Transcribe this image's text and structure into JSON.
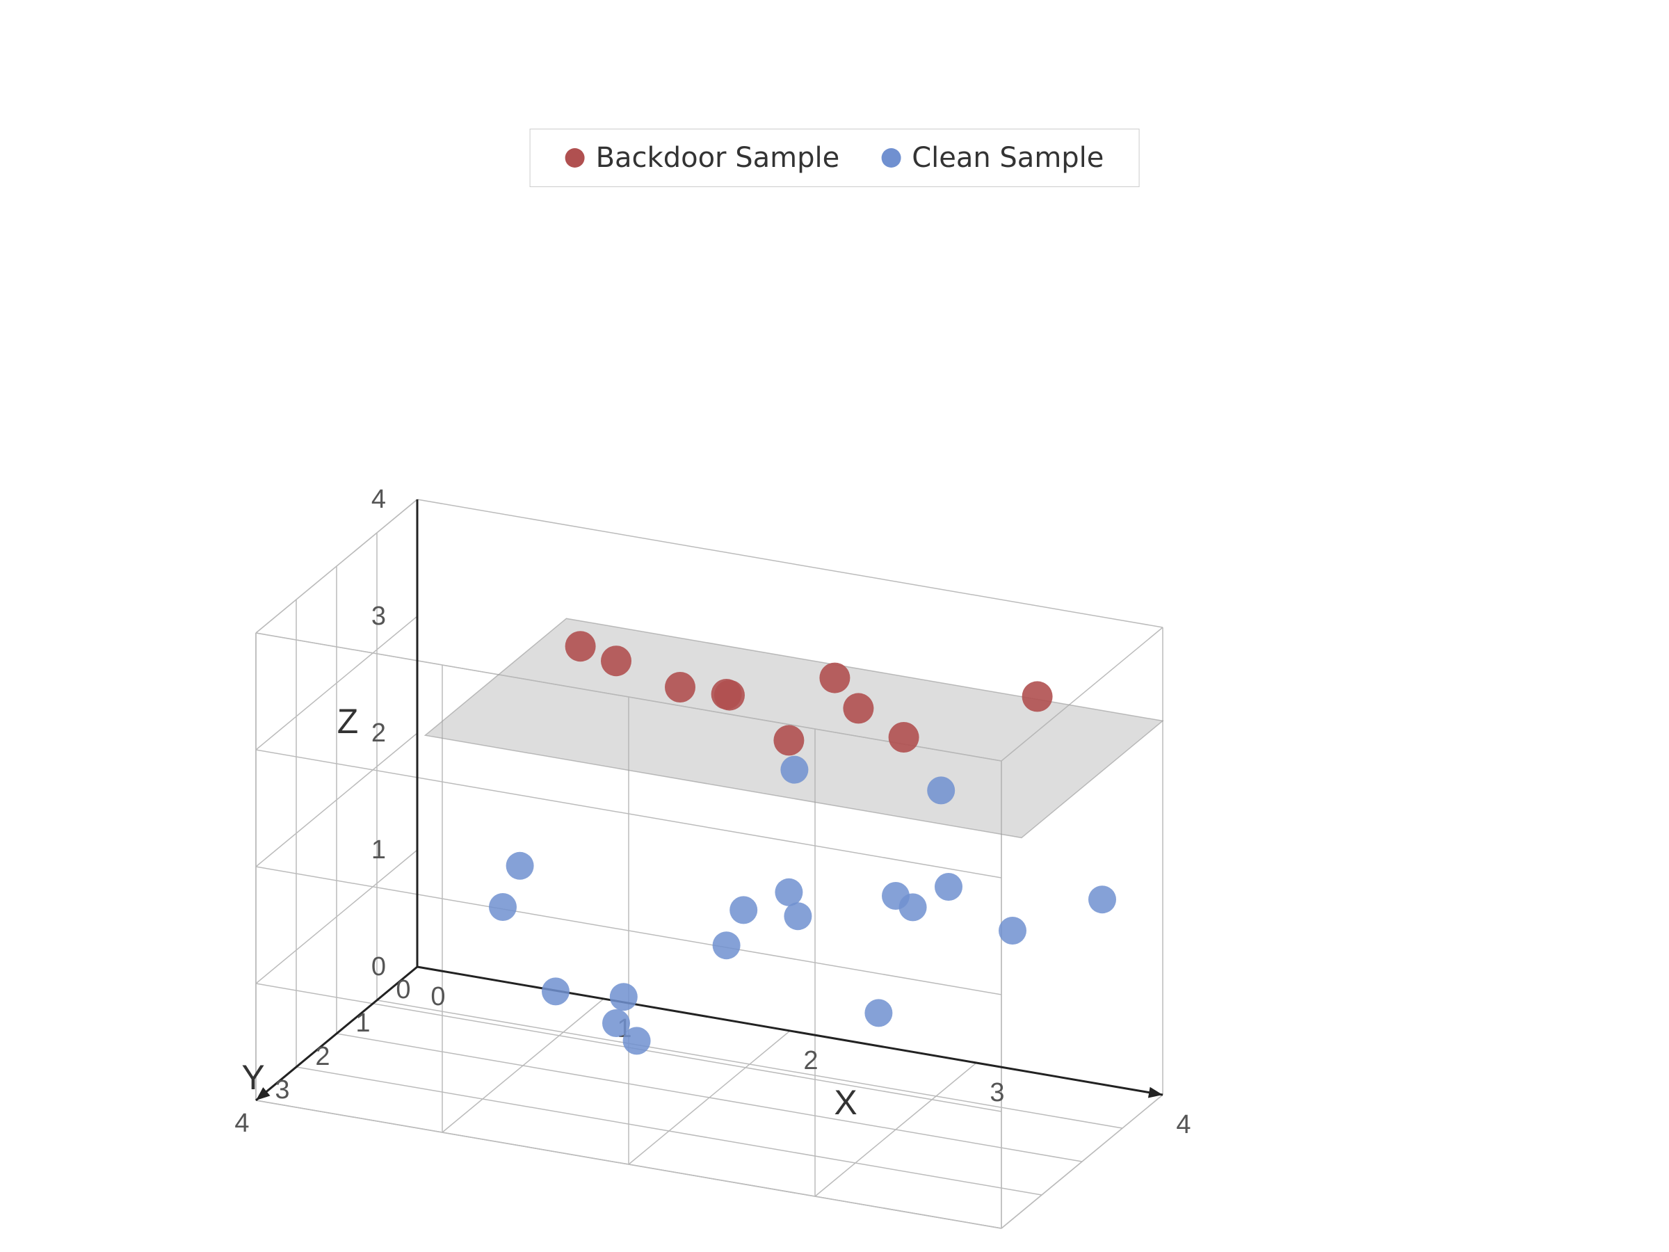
{
  "legend": {
    "backdoor_label": "Backdoor Sample",
    "clean_label": "Clean Sample",
    "backdoor_color": "#b05050",
    "clean_color": "#7090d0"
  },
  "axes": {
    "x_label": "X",
    "y_label": "Y",
    "z_label": "Z",
    "x_ticks": [
      "0",
      "1",
      "2",
      "3",
      "4"
    ],
    "y_ticks": [
      "0",
      "1",
      "2",
      "3",
      "4"
    ],
    "z_ticks": [
      "0",
      "1",
      "2",
      "3",
      "4"
    ]
  },
  "backdoor_points": [
    {
      "x": 1.2,
      "y": 1.5,
      "z": 3.5
    },
    {
      "x": 1.5,
      "y": 2.0,
      "z": 3.6
    },
    {
      "x": 1.8,
      "y": 1.8,
      "z": 3.4
    },
    {
      "x": 2.0,
      "y": 1.5,
      "z": 3.3
    },
    {
      "x": 2.2,
      "y": 2.5,
      "z": 3.65
    },
    {
      "x": 2.5,
      "y": 1.2,
      "z": 3.5
    },
    {
      "x": 2.8,
      "y": 2.0,
      "z": 3.55
    },
    {
      "x": 3.0,
      "y": 1.8,
      "z": 3.3
    },
    {
      "x": 3.5,
      "y": 0.8,
      "z": 3.5
    },
    {
      "x": 2.6,
      "y": 2.8,
      "z": 3.45
    }
  ],
  "clean_points": [
    {
      "x": 1.0,
      "y": 2.5,
      "z": 1.5
    },
    {
      "x": 1.2,
      "y": 3.0,
      "z": 2.05
    },
    {
      "x": 1.5,
      "y": 3.5,
      "z": 1.2
    },
    {
      "x": 1.8,
      "y": 3.2,
      "z": 1.15
    },
    {
      "x": 2.0,
      "y": 3.8,
      "z": 1.0
    },
    {
      "x": 2.2,
      "y": 2.5,
      "z": 1.5
    },
    {
      "x": 2.4,
      "y": 3.0,
      "z": 2.0
    },
    {
      "x": 2.6,
      "y": 2.8,
      "z": 2.15
    },
    {
      "x": 2.8,
      "y": 3.5,
      "z": 2.2
    },
    {
      "x": 3.0,
      "y": 2.0,
      "z": 2.0
    },
    {
      "x": 3.2,
      "y": 2.5,
      "z": 2.1
    },
    {
      "x": 3.5,
      "y": 3.0,
      "z": 2.5
    },
    {
      "x": 3.8,
      "y": 2.8,
      "z": 2.15
    },
    {
      "x": 4.0,
      "y": 1.5,
      "z": 2.1
    },
    {
      "x": 2.5,
      "y": 2.2,
      "z": 3.0
    },
    {
      "x": 3.2,
      "y": 1.8,
      "z": 2.9
    },
    {
      "x": 1.5,
      "y": 2.0,
      "z": 0.5
    },
    {
      "x": 2.8,
      "y": 1.5,
      "z": 0.8
    }
  ]
}
